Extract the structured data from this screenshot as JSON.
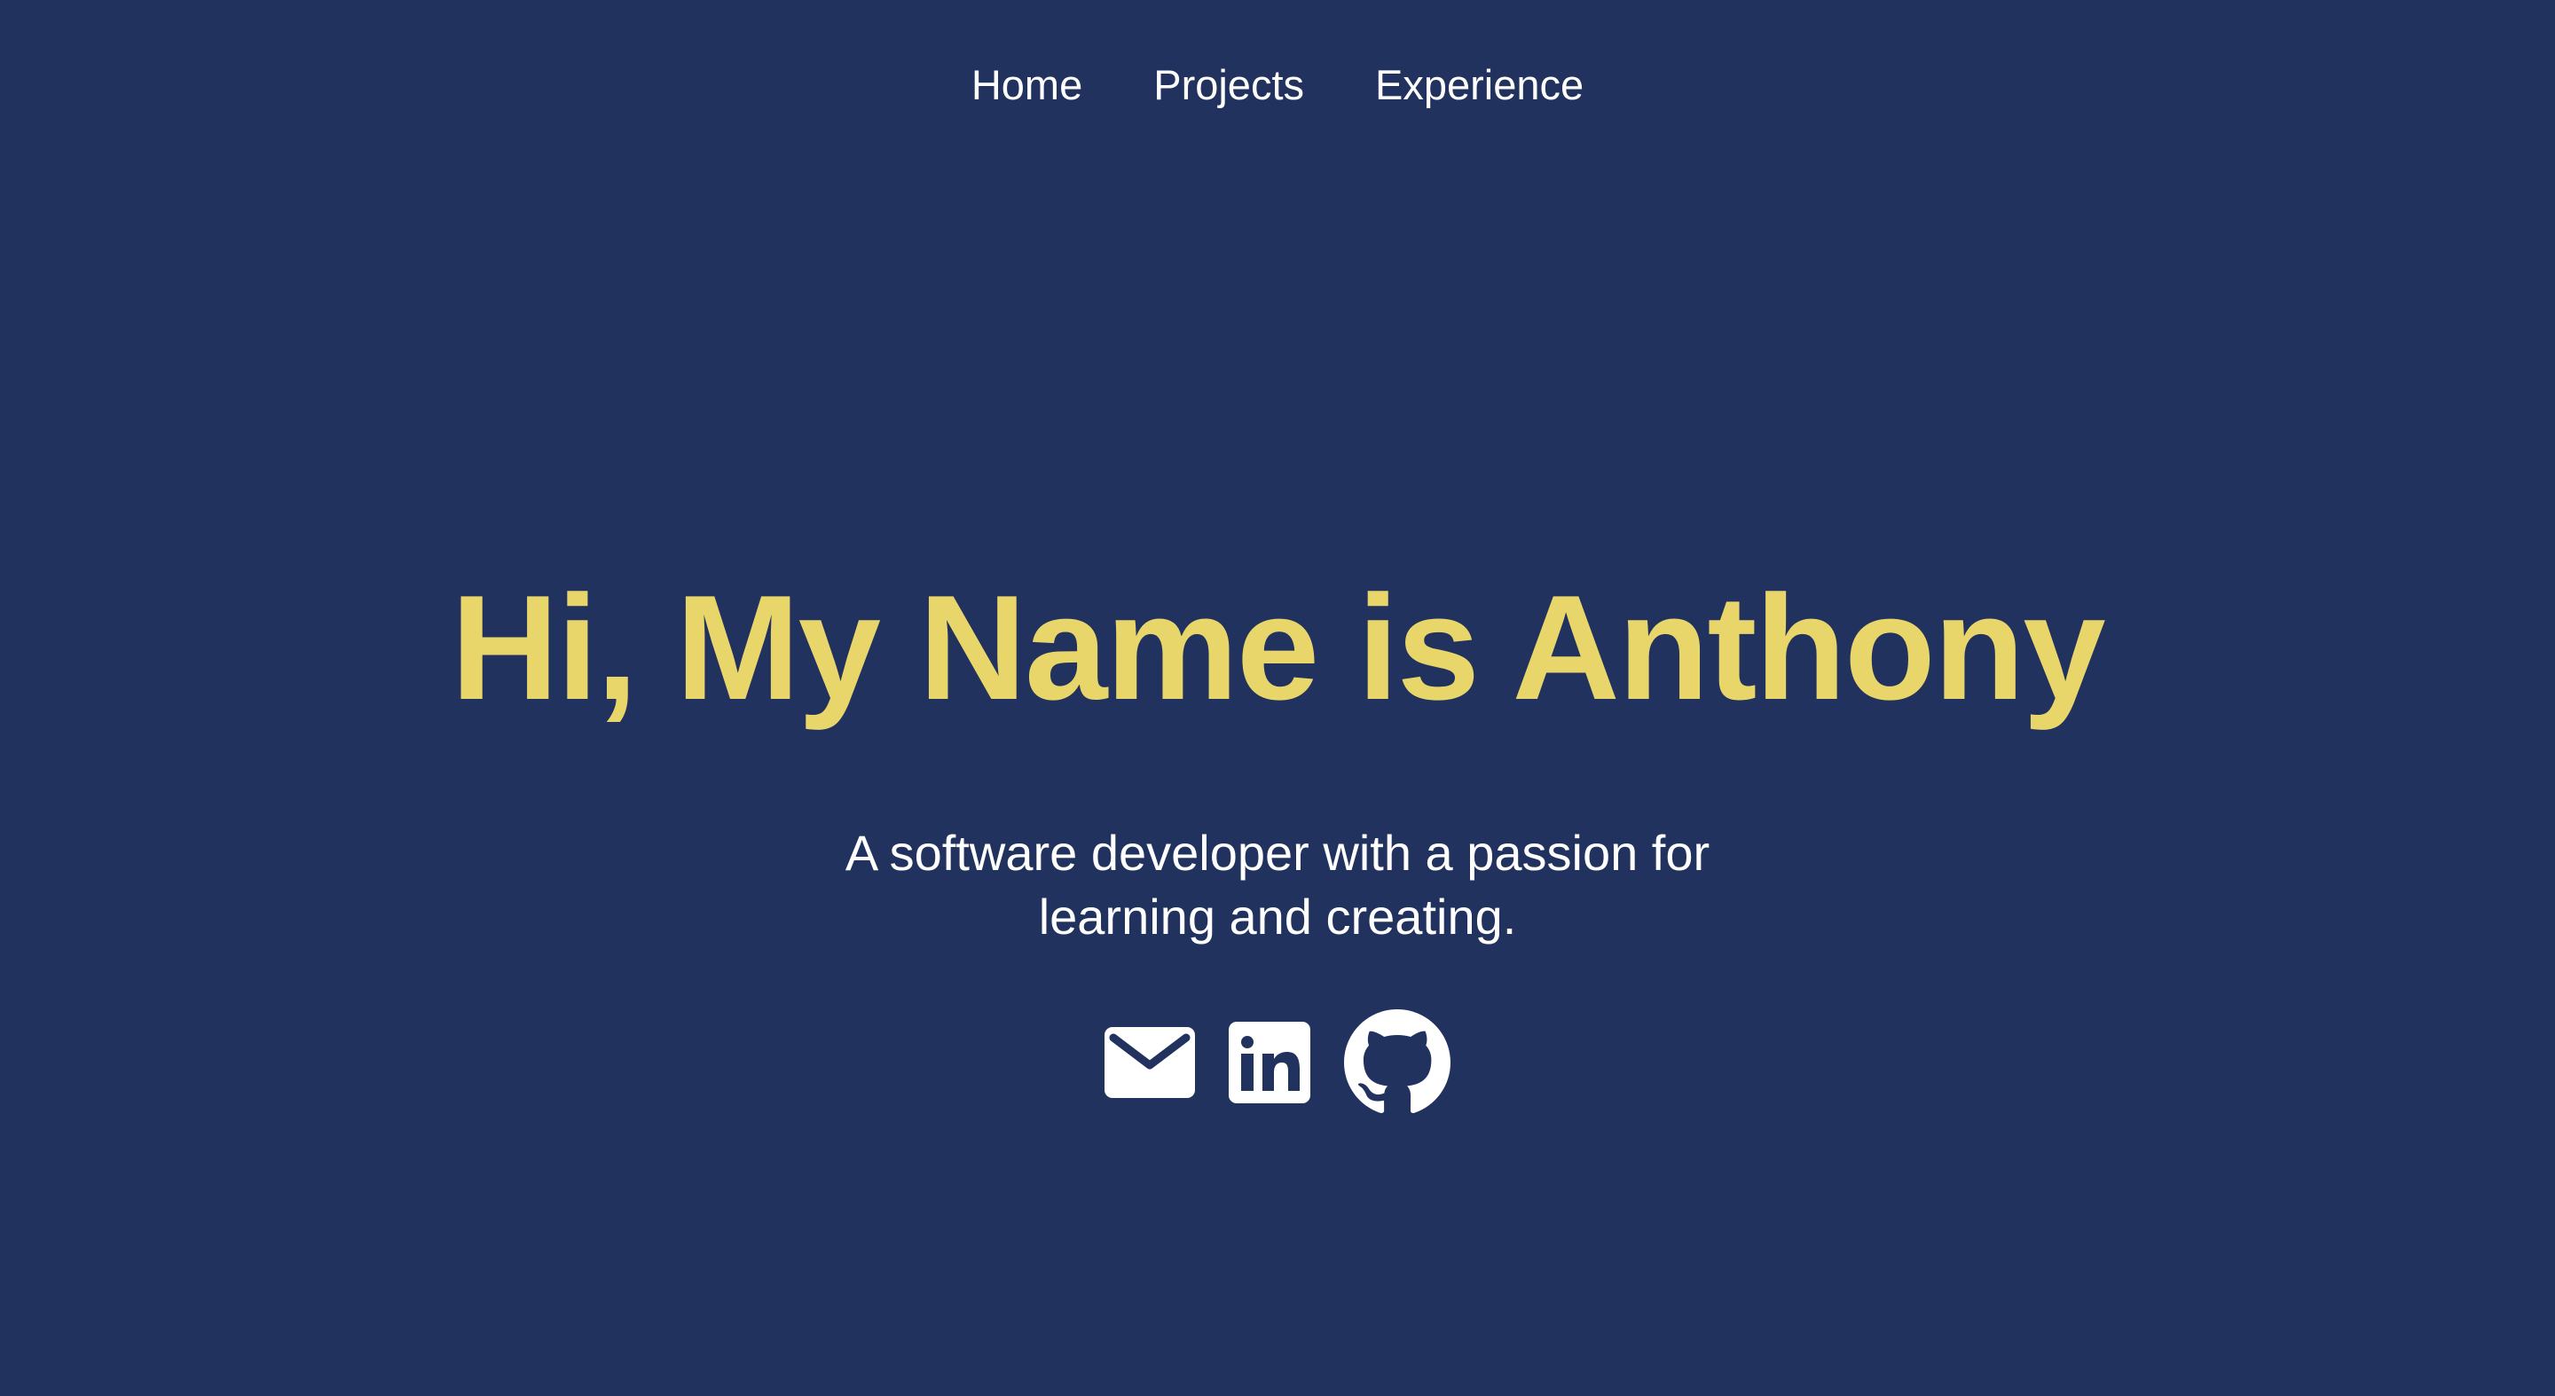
{
  "nav": {
    "items": [
      {
        "label": "Home"
      },
      {
        "label": "Projects"
      },
      {
        "label": "Experience"
      }
    ]
  },
  "hero": {
    "title": "Hi, My Name is Anthony",
    "subtitle": "A software developer with a passion for learning and creating."
  },
  "socials": [
    {
      "icon": "email-icon"
    },
    {
      "icon": "linkedin-icon"
    },
    {
      "icon": "github-icon"
    }
  ],
  "colors": {
    "background": "#21325e",
    "accent": "#e9d66b",
    "text": "#ffffff"
  }
}
